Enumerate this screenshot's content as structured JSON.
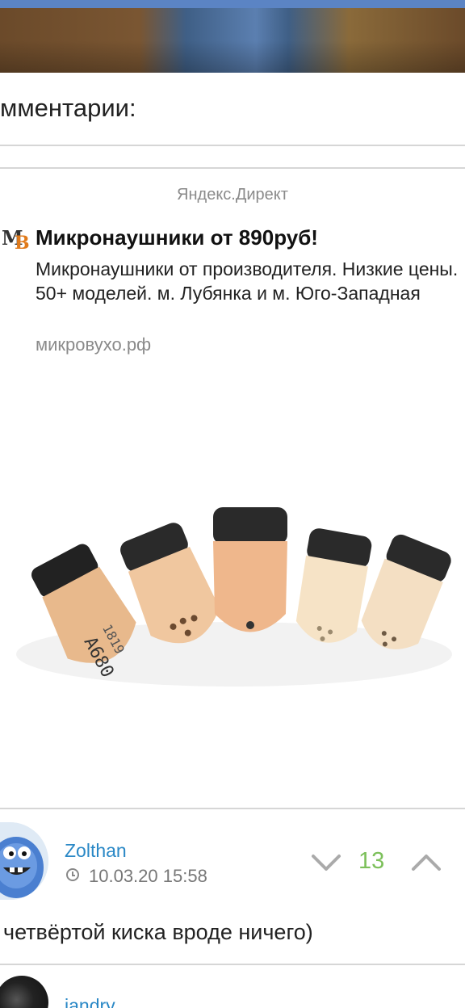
{
  "comments_header": {
    "title": "мментарии:"
  },
  "ad": {
    "source": "Яндекс.Директ",
    "logo_letters": [
      "M",
      "B"
    ],
    "title": "Микронаушники от 890руб!",
    "text": "Микронаушники от производителя. Низкие цены. 50+ моделей. м. Лубянка и м. Юго-Западная",
    "link": "микровухо.рф",
    "image_labels": [
      "A680",
      "1819"
    ]
  },
  "comment": {
    "author": "Zolthan",
    "date": "10.03.20 15:58",
    "score": "13",
    "text": "четвёртой киска вроде ничего)",
    "icons": {
      "clock": "clock-icon",
      "down": "chevron-down-icon",
      "up": "chevron-up-icon"
    },
    "colors": {
      "author": "#2a88c6",
      "score": "#7cc05a"
    }
  },
  "next_comment": {
    "author": "iandry"
  }
}
